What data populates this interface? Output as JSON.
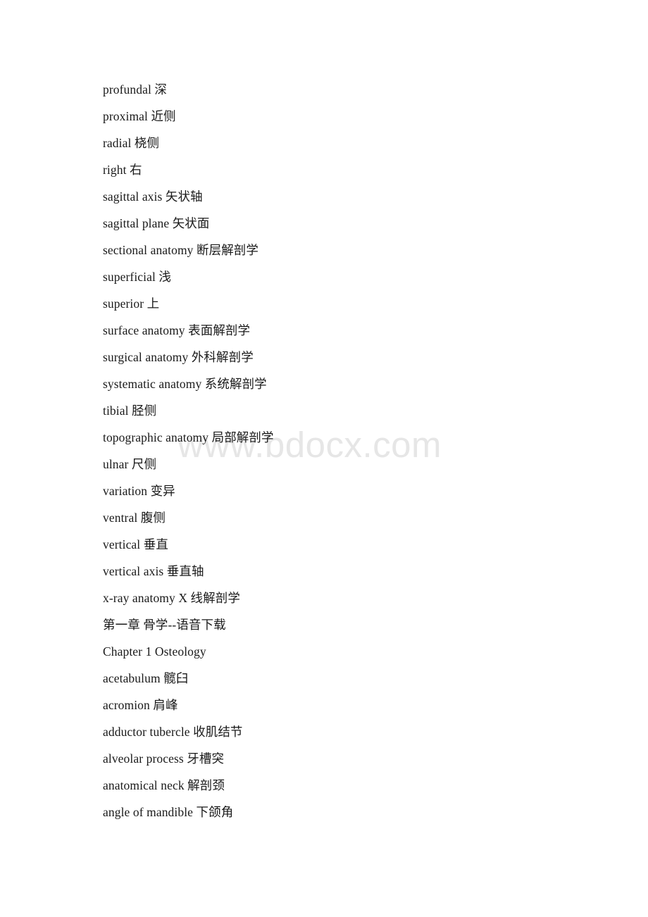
{
  "document": {
    "type": "scanned-document-page",
    "page_background": "#ffffff",
    "text_color": "#1a1a1a"
  },
  "watermark": {
    "text": "www.bdocx.com",
    "color": "#e6e6e6"
  },
  "content": {
    "lines": [
      {
        "text": "profundal 深"
      },
      {
        "text": "proximal 近侧"
      },
      {
        "text": "radial 桡侧"
      },
      {
        "text": "right 右"
      },
      {
        "text": "sagittal axis 矢状轴"
      },
      {
        "text": "sagittal plane 矢状面"
      },
      {
        "text": "sectional anatomy 断层解剖学"
      },
      {
        "text": "superficial 浅"
      },
      {
        "text": "superior 上"
      },
      {
        "text": "surface anatomy 表面解剖学"
      },
      {
        "text": "surgical anatomy 外科解剖学"
      },
      {
        "text": "systematic anatomy 系统解剖学"
      },
      {
        "text": "tibial 胫侧"
      },
      {
        "text": "topographic anatomy 局部解剖学"
      },
      {
        "text": "ulnar 尺侧"
      },
      {
        "text": "variation 变异"
      },
      {
        "text": "ventral 腹侧"
      },
      {
        "text": "vertical 垂直"
      },
      {
        "text": "vertical axis 垂直轴"
      },
      {
        "text": "x-ray anatomy X 线解剖学"
      },
      {
        "text": "第一章 骨学--语音下载"
      },
      {
        "text": "Chapter 1 Osteology"
      },
      {
        "text": "acetabulum 髋臼"
      },
      {
        "text": "acromion 肩峰"
      },
      {
        "text": "adductor tubercle 收肌结节"
      },
      {
        "text": "alveolar process 牙槽突"
      },
      {
        "text": "anatomical neck 解剖颈"
      },
      {
        "text": "angle of mandible 下颌角"
      }
    ]
  }
}
